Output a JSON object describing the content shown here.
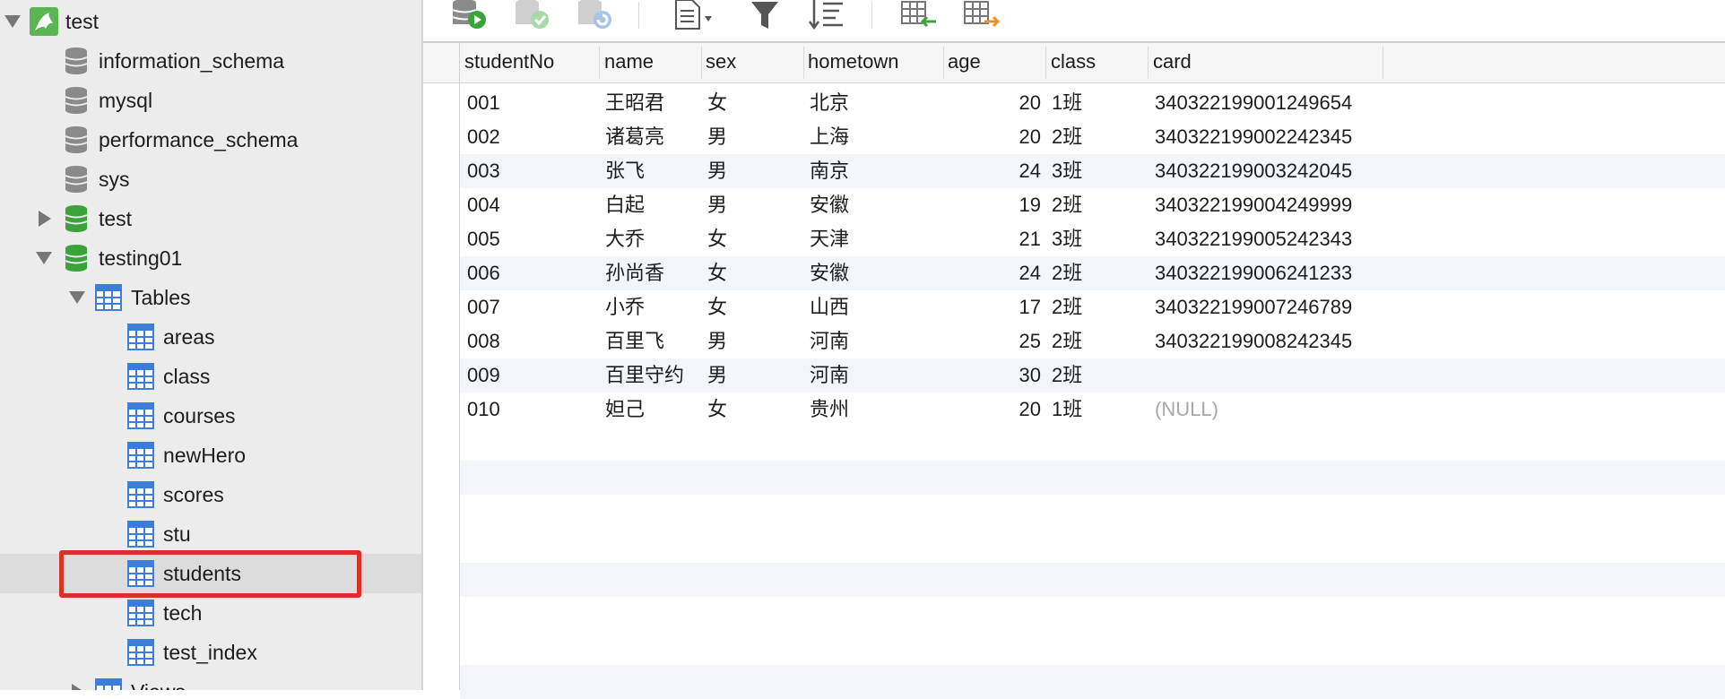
{
  "sidebar": {
    "connection": "test",
    "databases": [
      {
        "name": "information_schema"
      },
      {
        "name": "mysql"
      },
      {
        "name": "performance_schema"
      },
      {
        "name": "sys"
      },
      {
        "name": "test"
      },
      {
        "name": "testing01"
      }
    ],
    "tables_group": "Tables",
    "tables": [
      "areas",
      "class",
      "courses",
      "newHero",
      "scores",
      "stu",
      "students",
      "tech",
      "test_index"
    ],
    "views_group": "Views",
    "selected_table": "students"
  },
  "colors": {
    "highlight": "#d9302a",
    "connection_icon": "#5ab552",
    "db_gray": "#8a8a8a",
    "db_green": "#3aa43a",
    "table_icon": "#3d7ed8"
  },
  "grid": {
    "columns": [
      "studentNo",
      "name",
      "sex",
      "hometown",
      "age",
      "class",
      "card"
    ],
    "rows": [
      {
        "studentNo": "001",
        "name": "王昭君",
        "sex": "女",
        "hometown": "北京",
        "age": "20",
        "class": "1班",
        "card": "340322199001249654"
      },
      {
        "studentNo": "002",
        "name": "诸葛亮",
        "sex": "男",
        "hometown": "上海",
        "age": "20",
        "class": "2班",
        "card": "340322199002242345"
      },
      {
        "studentNo": "003",
        "name": "张飞",
        "sex": "男",
        "hometown": "南京",
        "age": "24",
        "class": "3班",
        "card": "340322199003242045"
      },
      {
        "studentNo": "004",
        "name": "白起",
        "sex": "男",
        "hometown": "安徽",
        "age": "19",
        "class": "2班",
        "card": "340322199004249999"
      },
      {
        "studentNo": "005",
        "name": "大乔",
        "sex": "女",
        "hometown": "天津",
        "age": "21",
        "class": "3班",
        "card": "340322199005242343"
      },
      {
        "studentNo": "006",
        "name": "孙尚香",
        "sex": "女",
        "hometown": "安徽",
        "age": "24",
        "class": "2班",
        "card": "340322199006241233"
      },
      {
        "studentNo": "007",
        "name": "小乔",
        "sex": "女",
        "hometown": "山西",
        "age": "17",
        "class": "2班",
        "card": "340322199007246789"
      },
      {
        "studentNo": "008",
        "name": "百里飞",
        "sex": "男",
        "hometown": "河南",
        "age": "25",
        "class": "2班",
        "card": "340322199008242345"
      },
      {
        "studentNo": "009",
        "name": "百里守约",
        "sex": "男",
        "hometown": "河南",
        "age": "30",
        "class": "2班",
        "card": ""
      },
      {
        "studentNo": "010",
        "name": "妲己",
        "sex": "女",
        "hometown": "贵州",
        "age": "20",
        "class": "1班",
        "card": "(NULL)"
      }
    ]
  },
  "toolbar_icons": [
    "run-query-icon",
    "apply-changes-icon",
    "discard-changes-icon",
    "text-view-icon",
    "filter-icon",
    "sort-icon",
    "import-icon",
    "export-icon"
  ]
}
